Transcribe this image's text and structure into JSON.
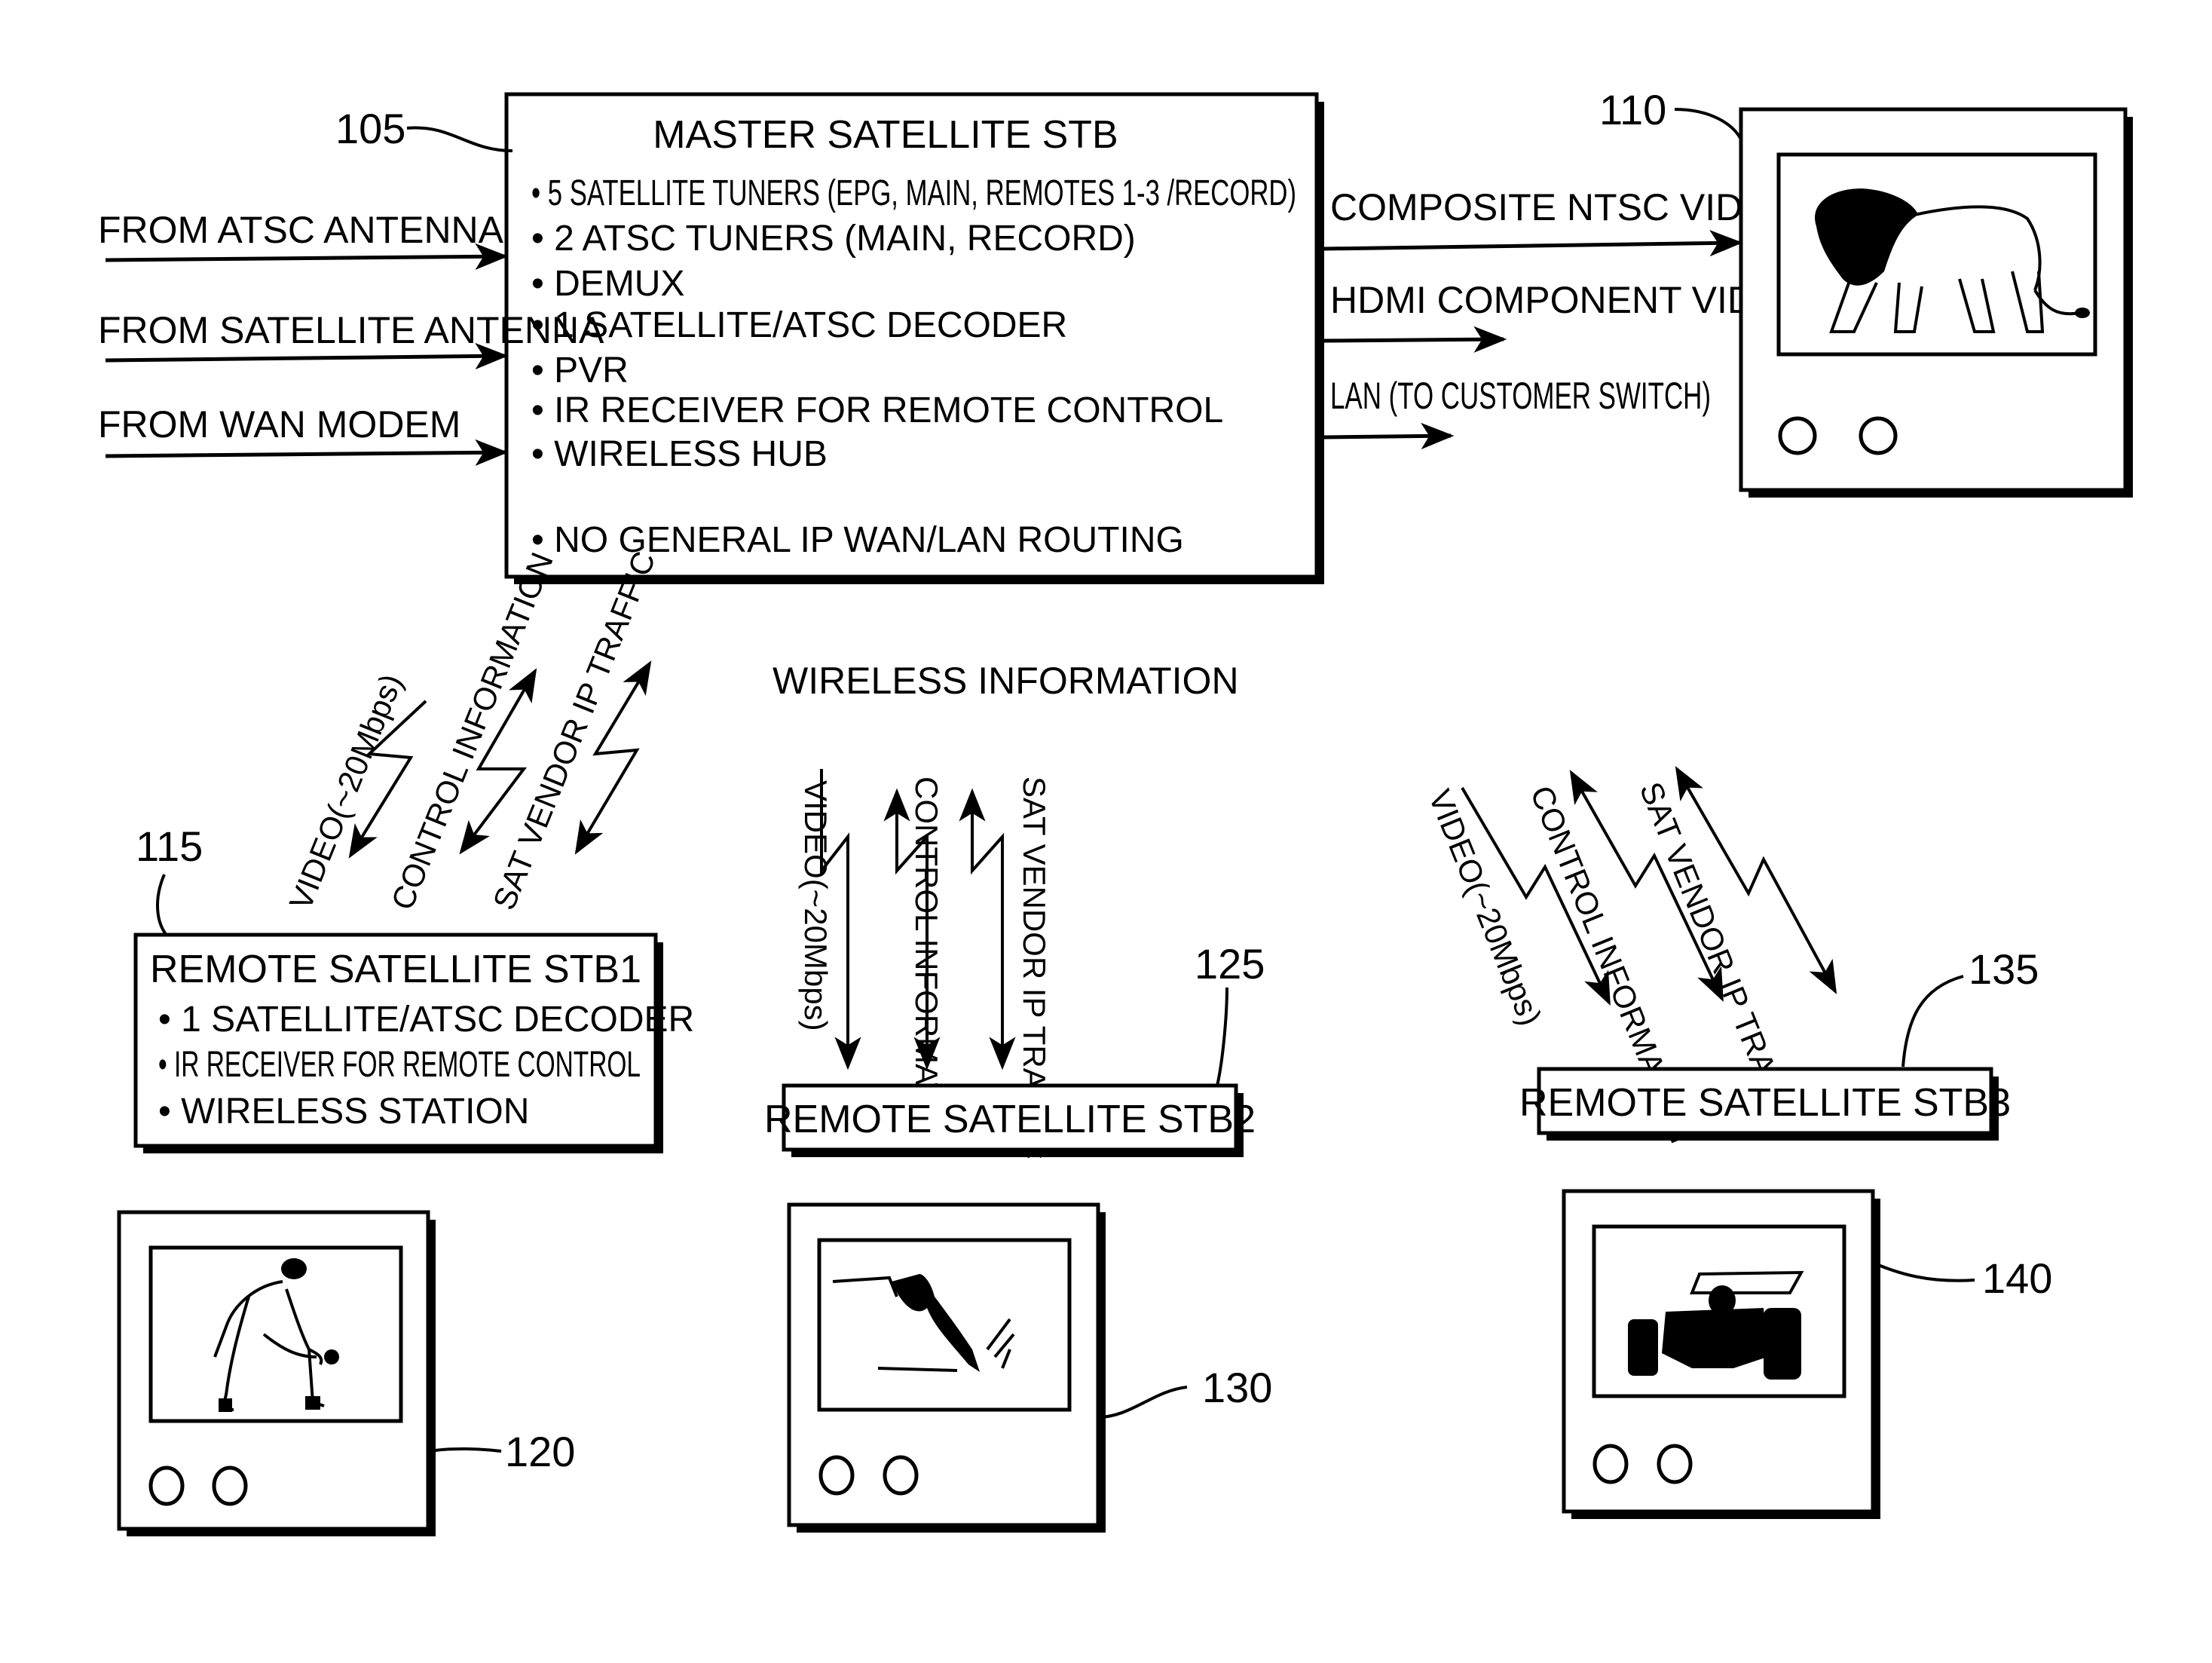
{
  "inputs": [
    {
      "label": "FROM ATSC ANTENNA"
    },
    {
      "label": "FROM SATELLITE ANTENNA"
    },
    {
      "label": "FROM WAN MODEM"
    }
  ],
  "master": {
    "ref": "105",
    "title": "MASTER SATELLITE STB",
    "bullets": [
      "5 SATELLITE TUNERS (EPG, MAIN, REMOTES 1-3 /RECORD)",
      "2 ATSC TUNERS (MAIN, RECORD)",
      "DEMUX",
      "1 SATELLITE/ATSC DECODER",
      "PVR",
      "IR RECEIVER FOR REMOTE CONTROL",
      "WIRELESS HUB",
      "NO GENERAL IP WAN/LAN ROUTING"
    ]
  },
  "outputs": [
    {
      "label": "COMPOSITE NTSC VIDEO"
    },
    {
      "label": "HDMI COMPONENT VIDEO"
    },
    {
      "label": "LAN (TO CUSTOMER SWITCH)"
    }
  ],
  "tv_main": {
    "ref": "110",
    "image": "lion"
  },
  "wireless_label": "WIRELESS INFORMATION",
  "links": {
    "video": "VIDEO(~20Mbps)",
    "control": "CONTROL INFORMATION",
    "sat_vendor": "SAT VENDOR IP TRAFFIC",
    "sat_vendor_stb2": "SAT VENDOR IP TRAFFIC"
  },
  "remotes": [
    {
      "ref": "115",
      "title": "REMOTE SATELLITE STB1",
      "bullets": [
        "1 SATELLITE/ATSC DECODER",
        "IR RECEIVER FOR REMOTE CONTROL",
        "WIRELESS STATION"
      ]
    },
    {
      "ref": "125",
      "title": "REMOTE SATELLITE STB2",
      "bullets": []
    },
    {
      "ref": "135",
      "title": "REMOTE SATELLITE STB3",
      "bullets": []
    }
  ],
  "tvs": [
    {
      "ref": "120",
      "image": "baseball-player"
    },
    {
      "ref": "130",
      "image": "water-skier"
    },
    {
      "ref": "140",
      "image": "race-car"
    }
  ]
}
